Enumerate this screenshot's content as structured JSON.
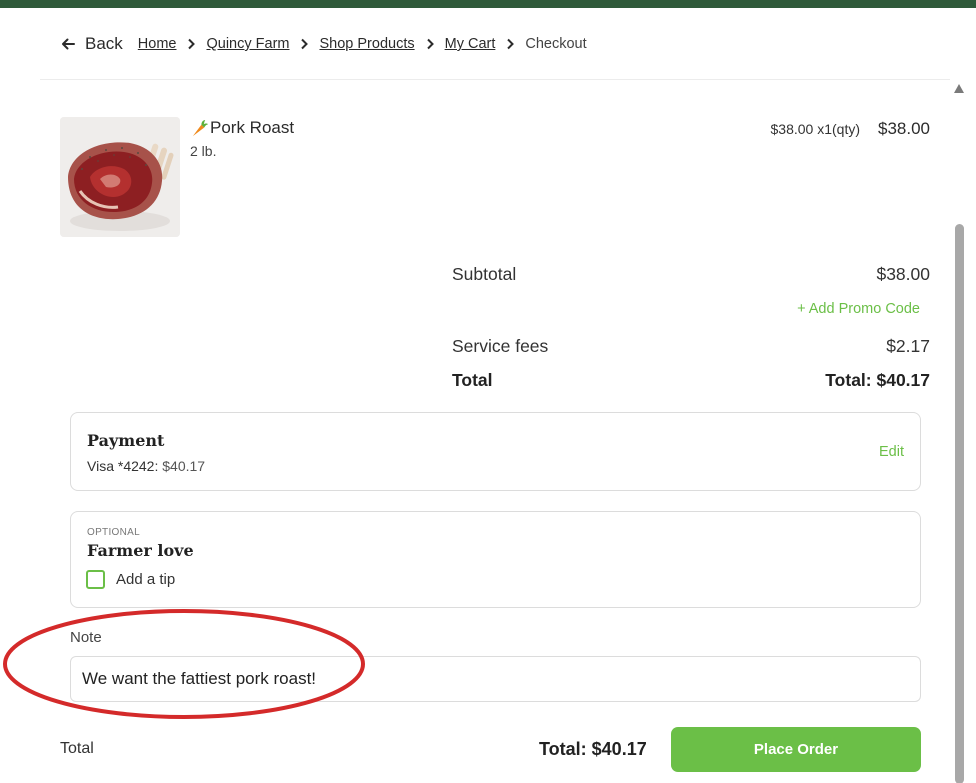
{
  "nav": {
    "back_label": "Back",
    "breadcrumbs": [
      "Home",
      "Quincy Farm",
      "Shop Products",
      "My Cart"
    ],
    "current": "Checkout"
  },
  "product": {
    "icon": "carrot-icon",
    "name": "Pork Roast",
    "weight": "2 lb.",
    "price_detail": "$38.00 x1(qty)",
    "price": "$38.00"
  },
  "summary": {
    "subtotal_label": "Subtotal",
    "subtotal_value": "$38.00",
    "promo_label": "+ Add Promo Code",
    "fees_label": "Service fees",
    "fees_value": "$2.17",
    "total_label": "Total",
    "total_value": "Total: $40.17"
  },
  "payment": {
    "title": "Payment",
    "card": "Visa *4242:",
    "amount": "$40.17",
    "edit_label": "Edit"
  },
  "tip": {
    "optional_label": "OPTIONAL",
    "title": "Farmer love",
    "checkbox_label": "Add a tip",
    "checked": false
  },
  "note": {
    "label": "Note",
    "value": "We want the fattiest pork roast!"
  },
  "footer": {
    "label": "Total",
    "total": "Total: $40.17",
    "place_order_label": "Place Order"
  },
  "colors": {
    "accent": "#6bbf47",
    "topbar": "#2f5a3a",
    "annotation": "#d42a2a"
  }
}
